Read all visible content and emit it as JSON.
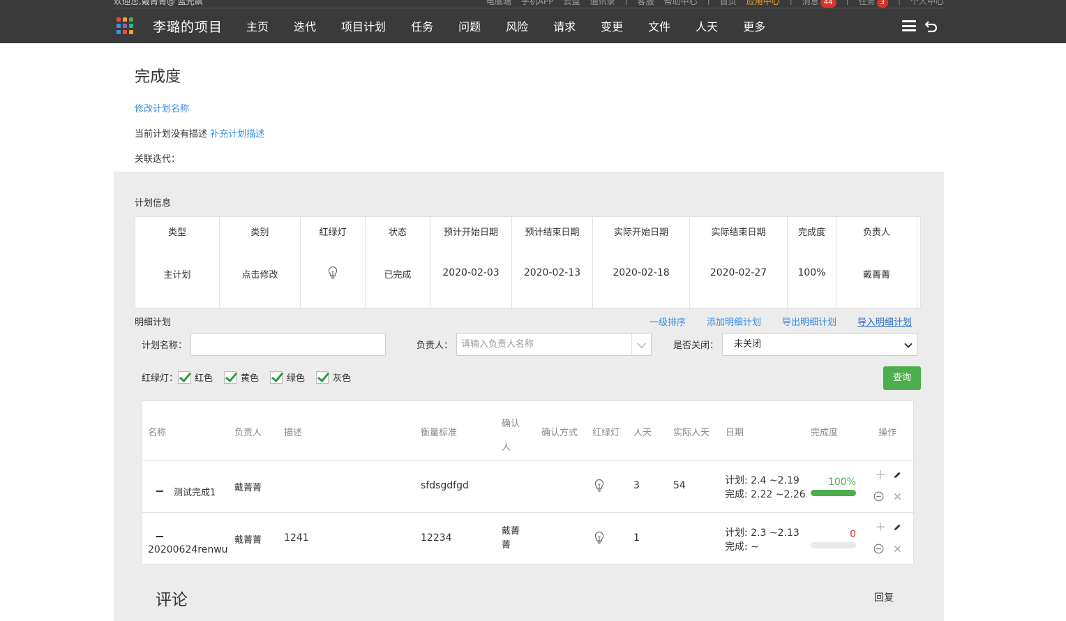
{
  "topstrip": {
    "welcome": "欢迎您,戴菁菁@ 蓝光飙",
    "links": [
      "电脑端",
      "手机APP",
      "云盘",
      "通讯录",
      "|",
      "客服",
      "帮助中心",
      "|",
      "首页",
      "应用中心",
      "|",
      "消息",
      "|",
      "任务",
      "|",
      "个人中心"
    ],
    "messages_count": "44",
    "tasks_count": "3",
    "highlight_color": "#f0a030"
  },
  "header": {
    "project_title": "李璐的项目",
    "nav": [
      "主页",
      "迭代",
      "项目计划",
      "任务",
      "问题",
      "风险",
      "请求",
      "变更",
      "文件",
      "人天",
      "更多"
    ],
    "apps_icon_colors": [
      "#e94b3c",
      "#f5a623",
      "#4cae4c",
      "#3a8ee6",
      "#9b59b6",
      "#1abc9c",
      "#3a8ee6",
      "#e94b3c",
      "#f5a623"
    ]
  },
  "page": {
    "title": "完成度",
    "rename_link": "修改计划名称",
    "desc_prefix": "当前计划没有描述",
    "desc_link": "补充计划描述",
    "iteration_label": "关联迭代："
  },
  "plan_info": {
    "label": "计划信息",
    "columns": [
      {
        "h": "类型",
        "v": "主计划"
      },
      {
        "h": "类别",
        "v": "点击修改"
      },
      {
        "h": "红绿灯",
        "v": ""
      },
      {
        "h": "状态",
        "v": "已完成"
      },
      {
        "h": "预计开始日期",
        "v": "2020-02-03"
      },
      {
        "h": "预计结束日期",
        "v": "2020-02-13"
      },
      {
        "h": "实际开始日期",
        "v": "2020-02-18"
      },
      {
        "h": "实际结束日期",
        "v": "2020-02-27"
      },
      {
        "h": "完成度",
        "v": "100%"
      },
      {
        "h": "负责人",
        "v": "戴菁菁"
      }
    ]
  },
  "detail": {
    "label": "明细计划",
    "actions": [
      "一级排序",
      "添加明细计划",
      "导出明细计划",
      "导入明细计划"
    ],
    "filters": {
      "name_label": "计划名称：",
      "name_value": "",
      "owner_label": "负责人：",
      "owner_placeholder": "请输入负责人名称",
      "closed_label": "是否关闭：",
      "closed_value": "未关闭",
      "light_label": "红绿灯：",
      "lights": [
        "红色",
        "黄色",
        "绿色",
        "灰色"
      ],
      "query_button": "查询"
    },
    "columns": [
      "名称",
      "负责人",
      "描述",
      "衡量标准",
      "确认人",
      "确认方式",
      "红绿灯",
      "人天",
      "实际人天",
      "日期",
      "完成度",
      "操作"
    ],
    "rows": [
      {
        "name": "测试完成1",
        "owner": "戴菁菁",
        "desc": "",
        "measure": "sfdsgdfgd",
        "confirmer": "",
        "days": "3",
        "actual_days": "54",
        "plan_date": "计划: 2.4 ~2.19",
        "done_date": "完成: 2.22 ~2.26",
        "progress_text": "100%",
        "progress": 1.0
      },
      {
        "name": "20200624renwu",
        "owner": "戴菁菁",
        "desc": "1241",
        "measure": "12234",
        "confirmer": "戴菁菁",
        "days": "1",
        "actual_days": "",
        "plan_date": "计划: 2.3 ~2.13",
        "done_date": "完成: ~",
        "progress_text": "0",
        "progress": 0.0
      }
    ]
  },
  "comments": {
    "title": "评论",
    "reply": "回复"
  }
}
